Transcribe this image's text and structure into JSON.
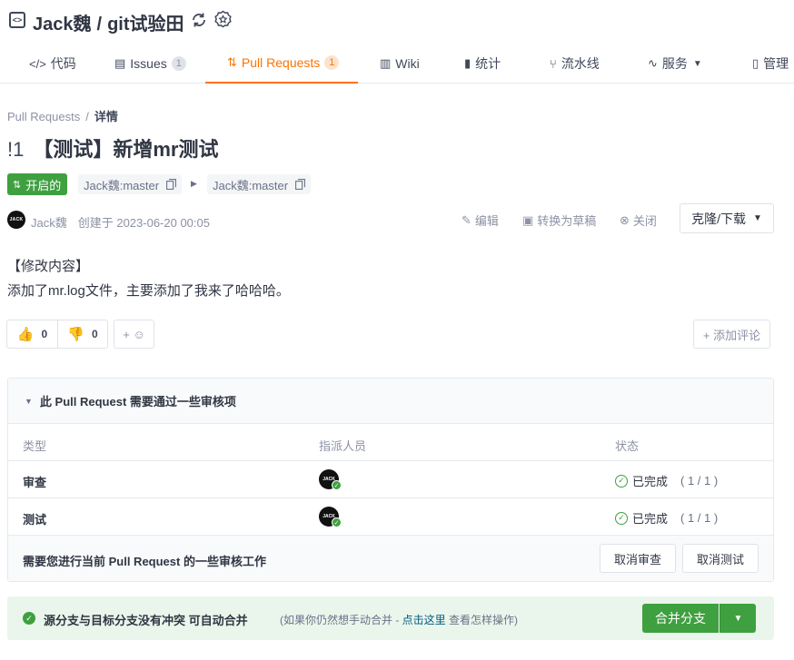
{
  "repo": {
    "owner": "Jack魏",
    "separator": "/",
    "name": "git试验田"
  },
  "tabs": [
    {
      "icon": "</>",
      "label": "代码"
    },
    {
      "icon": "▤",
      "label": "Issues",
      "count": "1"
    },
    {
      "icon": "⇅",
      "label": "Pull Requests",
      "count": "1"
    },
    {
      "icon": "▥",
      "label": "Wiki"
    },
    {
      "icon": "▮",
      "label": "统计"
    },
    {
      "icon": "⑂",
      "label": "流水线"
    },
    {
      "icon": "∿",
      "label": "服务"
    },
    {
      "icon": "▯",
      "label": "管理"
    }
  ],
  "breadcrumb": {
    "parent": "Pull Requests",
    "separator": "/",
    "current": "详情"
  },
  "pr": {
    "number": "!1",
    "title": "【测试】新增mr测试",
    "status": "开启的",
    "source_branch": "Jack魏:master",
    "target_branch": "Jack魏:master",
    "author": "Jack魏",
    "created": "创建于 2023-06-20 00:05",
    "avatar_text": "JACK"
  },
  "actions": {
    "edit": "编辑",
    "to_draft": "转换为草稿",
    "close": "关闭",
    "clone": "克隆/下载"
  },
  "description": {
    "line1": "【修改内容】",
    "line2": "添加了mr.log文件，主要添加了我来了哈哈哈。"
  },
  "reactions": {
    "thumbs_up": "0",
    "thumbs_down": "0",
    "add_emoji": "+ ☺",
    "add_comment": "+ 添加评论"
  },
  "review": {
    "header": "此 Pull Request 需要通过一些审核项",
    "columns": [
      "类型",
      "指派人员",
      "状态"
    ],
    "rows": [
      {
        "type": "审查",
        "status": "已完成",
        "progress": "( 1 / 1 )"
      },
      {
        "type": "测试",
        "status": "已完成",
        "progress": "( 1 / 1 )"
      }
    ],
    "footer_text": "需要您进行当前 Pull Request 的一些审核工作",
    "cancel_review": "取消审查",
    "cancel_test": "取消测试"
  },
  "merge": {
    "message": "源分支与目标分支没有冲突 可自动合并",
    "hint_prefix": "(如果你仍然想手动合并 - ",
    "hint_link": "点击这里",
    "hint_suffix": " 查看怎样操作)",
    "button": "合并分支"
  },
  "colors": {
    "accent": "#fe7300",
    "success": "#3fa040",
    "link": "#005980"
  }
}
